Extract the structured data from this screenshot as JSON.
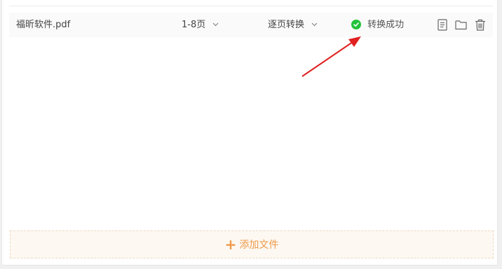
{
  "file_row": {
    "file_name": "福昕软件.pdf",
    "page_range": "1-8页",
    "mode": "逐页转换",
    "status": "转换成功",
    "icons": [
      "document-icon",
      "folder-icon",
      "trash-icon"
    ]
  },
  "add_button": {
    "plus": "+",
    "label": "添加文件"
  },
  "colors": {
    "success": "#22c33a",
    "accent": "#ee9a4a",
    "annotation_arrow": "#e02020"
  }
}
